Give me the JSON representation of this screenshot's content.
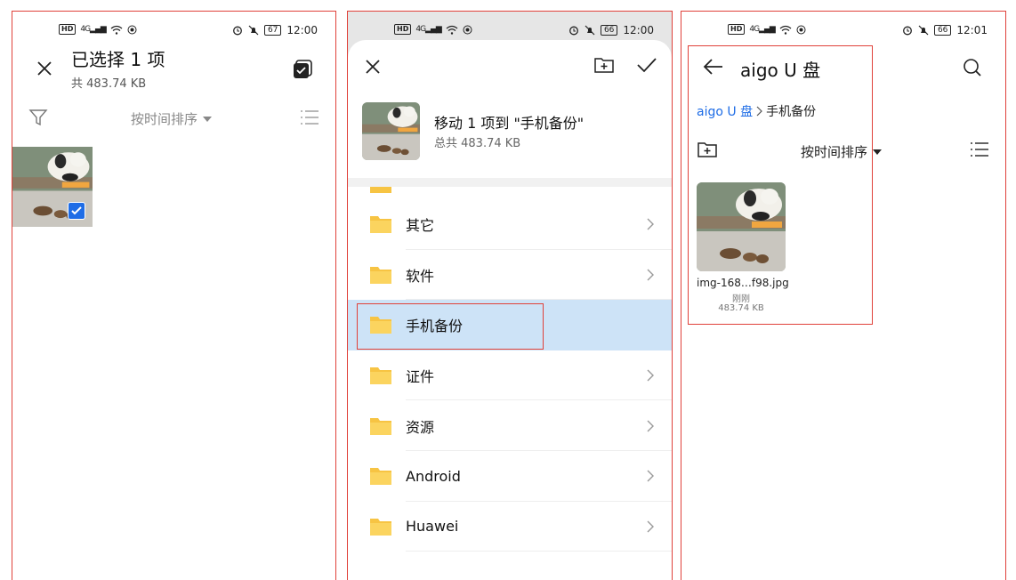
{
  "status1": {
    "time": "12:00",
    "battery": "67",
    "net": "4G"
  },
  "status2": {
    "time": "12:00",
    "battery": "66",
    "net": "4G"
  },
  "status3": {
    "time": "12:01",
    "battery": "66",
    "net": "4G"
  },
  "screen1": {
    "title": "已选择 1 项",
    "subtitle": "共 483.74 KB",
    "sort_label": "按时间排序"
  },
  "screen2": {
    "title": "移动 1 项到 \"手机备份\"",
    "subtitle": "总共 483.74 KB",
    "folders": [
      {
        "label": "其它"
      },
      {
        "label": "软件"
      },
      {
        "label": "手机备份"
      },
      {
        "label": "证件"
      },
      {
        "label": "资源"
      },
      {
        "label": "Android"
      },
      {
        "label": "Huawei"
      }
    ]
  },
  "screen3": {
    "title": "aigo U 盘",
    "breadcrumb": [
      "aigo U 盘",
      "手机备份"
    ],
    "sort_label": "按时间排序",
    "file": {
      "name": "img-168…f98.jpg",
      "time": "刚刚",
      "size": "483.74 KB"
    }
  },
  "colors": {
    "accent": "#1f6de6",
    "selection": "#cde3f7",
    "folder": "#f7c443",
    "annotation": "#e0413a"
  }
}
